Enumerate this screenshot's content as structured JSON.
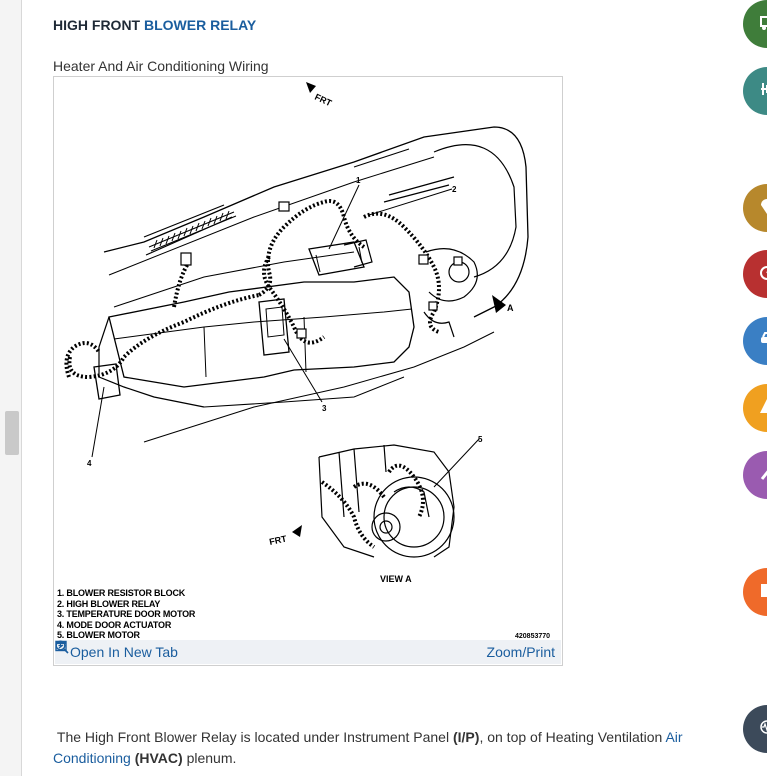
{
  "header": {
    "title_prefix": "HIGH FRONT ",
    "title_link": "BLOWER RELAY"
  },
  "figure": {
    "caption": "Heater And Air Conditioning Wiring",
    "diagram_labels": {
      "frt_top": "FRT",
      "frt_bottom": "FRT",
      "arrow_a": "A",
      "view_a": "VIEW  A",
      "callouts": [
        "1",
        "2",
        "3",
        "4",
        "5"
      ]
    },
    "legend": [
      "1. BLOWER RESISTOR BLOCK",
      "2. HIGH BLOWER RELAY",
      "3. TEMPERATURE DOOR MOTOR",
      "4. MODE DOOR ACTUATOR",
      "5. BLOWER MOTOR"
    ],
    "figure_number": "420853770",
    "open_tab_label": "Open In New Tab",
    "zoom_label": "Zoom/Print"
  },
  "body": {
    "p1": "The High Front Blower Relay is located under Instrument Panel ",
    "ip": "(I/P)",
    "p2": ", on top of Heating Ventilation ",
    "link1": "Air",
    "link2": "Conditioning",
    "hvac": "(HVAC)",
    "p3": " plenum."
  },
  "sidebar": {
    "buttons": [
      {
        "name": "truck",
        "color": "#3f7d3a"
      },
      {
        "name": "tools",
        "color": "#3d8a85"
      },
      {
        "name": "location",
        "color": "#b7882c"
      },
      {
        "name": "gauge",
        "color": "#b83030"
      },
      {
        "name": "car",
        "color": "#3a7fc4"
      },
      {
        "name": "warning",
        "color": "#f0a020"
      },
      {
        "name": "wrench",
        "color": "#9a5bb0"
      },
      {
        "name": "tsb",
        "color": "#ef6a2a"
      },
      {
        "name": "waveform",
        "color": "#3c4a5a"
      }
    ]
  }
}
